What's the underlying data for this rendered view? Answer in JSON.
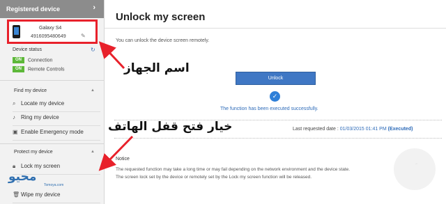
{
  "sidebar": {
    "registered_title": "Registered device",
    "chevron": "›",
    "device": {
      "name": "Galaxy S4",
      "id": "4916095480649",
      "icon": "phone-icon"
    },
    "status": {
      "title": "Device status",
      "items": [
        {
          "badge": "ON",
          "label": "Connection"
        },
        {
          "badge": "ON",
          "label": "Remote Controls"
        }
      ]
    },
    "find": {
      "title": "Find my device",
      "items": [
        {
          "label": "Locate my device",
          "icon": "search-icon"
        },
        {
          "label": "Ring my device",
          "icon": "bell-icon"
        },
        {
          "label": "Enable Emergency mode",
          "icon": "emergency-icon"
        }
      ]
    },
    "protect": {
      "title": "Protect my device",
      "items": [
        {
          "label": "Lock my screen",
          "icon": "lock-icon"
        },
        {
          "label": "Wipe my device",
          "icon": "trash-icon"
        }
      ]
    }
  },
  "main": {
    "title": "Unlock my screen",
    "subtitle": "You can unlock the device screen remotely.",
    "unlock_button": "Unlock",
    "success": "The function has been executed successfully.",
    "last_requested": {
      "label": "Last requested date :",
      "date": "01/03/2015 01:41 PM",
      "status": "(Executed)"
    },
    "notice": {
      "title": "Notice",
      "lines": [
        "The requested function may take a long time or may fail depending on the network environment and the device state.",
        "The screen lock set by the device or remotely set by the Lock my screen function will be released."
      ]
    }
  },
  "annotations": {
    "device_name": "اسم الجهاز",
    "unlock_option": "خيار فتح قفل الهاتف",
    "logo": "محيو",
    "logo_url": "Tomoya.com"
  },
  "colors": {
    "highlight": "#e8212b",
    "accent": "#3f77c4",
    "on_badge": "#5db839"
  }
}
